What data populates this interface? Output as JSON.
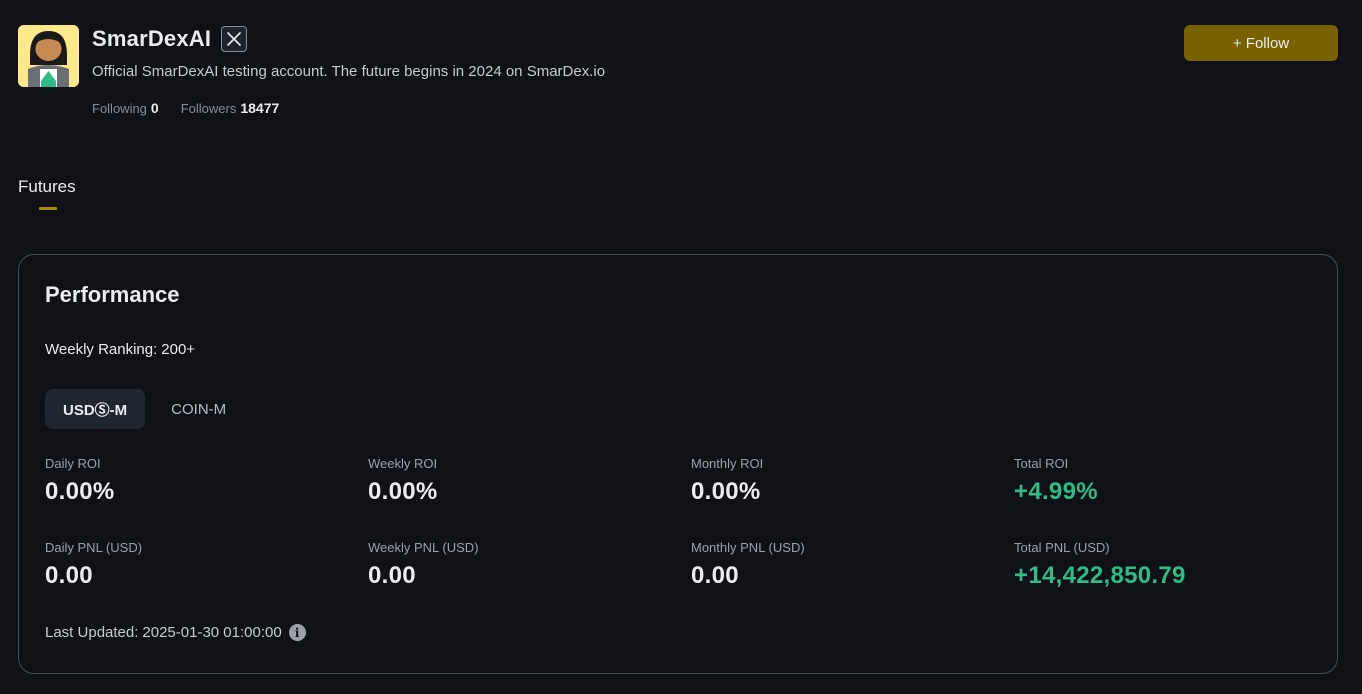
{
  "profile": {
    "name": "SmarDexAI",
    "bio": "Official SmarDexAI testing account. The future begins in 2024 on SmarDex.io",
    "following_label": "Following",
    "following_count": "0",
    "followers_label": "Followers",
    "followers_count": "18477",
    "follow_button": "+ Follow",
    "social_icon": "x-logo-icon"
  },
  "tabs": [
    {
      "label": "Futures",
      "active": true
    }
  ],
  "performance": {
    "title": "Performance",
    "ranking_label": "Weekly Ranking:",
    "ranking_value": "200+",
    "segments": [
      {
        "label": "USDⓈ-M",
        "active": true
      },
      {
        "label": "COIN-M",
        "active": false
      }
    ],
    "metrics": {
      "daily_roi": {
        "label": "Daily ROI",
        "value": "0.00%"
      },
      "weekly_roi": {
        "label": "Weekly ROI",
        "value": "0.00%"
      },
      "monthly_roi": {
        "label": "Monthly ROI",
        "value": "0.00%"
      },
      "total_roi": {
        "label": "Total ROI",
        "value": "+4.99%"
      },
      "daily_pnl": {
        "label": "Daily PNL (USD)",
        "value": "0.00"
      },
      "weekly_pnl": {
        "label": "Weekly PNL (USD)",
        "value": "0.00"
      },
      "monthly_pnl": {
        "label": "Monthly PNL (USD)",
        "value": "0.00"
      },
      "total_pnl": {
        "label": "Total PNL (USD)",
        "value": "+14,422,850.79"
      }
    },
    "updated_label": "Last Updated:",
    "updated_value": "2025-01-30 01:00:00",
    "info_icon": "info-icon"
  },
  "colors": {
    "background": "#0f1117",
    "accent": "#7a6100",
    "positive": "#2ebd85",
    "border": "#474d57"
  }
}
